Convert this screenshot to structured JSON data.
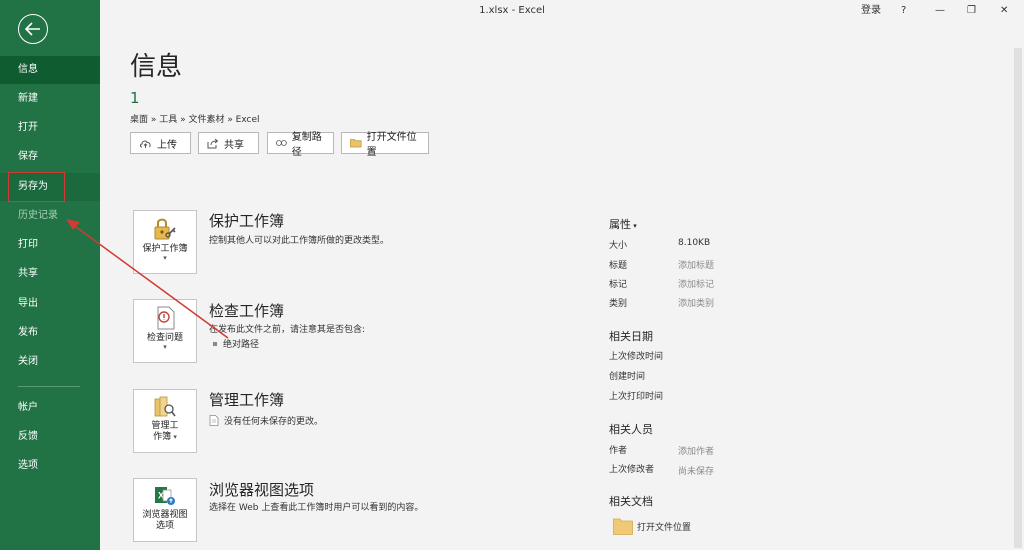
{
  "titlebar": {
    "title": "1.xlsx  -  Excel",
    "login": "登录",
    "help": "?",
    "minimize": "—",
    "restore": "❐",
    "close": "✕"
  },
  "sidebar": {
    "items": [
      {
        "label": "信息",
        "state": "active"
      },
      {
        "label": "新建"
      },
      {
        "label": "打开"
      },
      {
        "label": "保存"
      },
      {
        "label": "另存为",
        "state": "highlighted"
      },
      {
        "label": "历史记录",
        "state": "disabled"
      },
      {
        "label": "打印"
      },
      {
        "label": "共享"
      },
      {
        "label": "导出"
      },
      {
        "label": "发布"
      },
      {
        "label": "关闭"
      },
      {
        "label": "帐户"
      },
      {
        "label": "反馈"
      },
      {
        "label": "选项"
      }
    ]
  },
  "main": {
    "title": "信息",
    "file_name": "1",
    "breadcrumb": "桌面 » 工具 » 文件素材 » Excel",
    "buttons": {
      "upload": "上传",
      "share": "共享",
      "copy_path": "复制路径",
      "open_location": "打开文件位置"
    }
  },
  "sections": {
    "protect": {
      "card_label": "保护工作簿",
      "title": "保护工作簿",
      "desc": "控制其他人可以对此工作簿所做的更改类型。"
    },
    "inspect": {
      "card_label": "检查问题",
      "title": "检查工作簿",
      "desc": "在发布此文件之前，请注意其是否包含:",
      "bullet": "绝对路径"
    },
    "manage": {
      "card_label_1": "管理工",
      "card_label_2": "作簿",
      "title": "管理工作簿",
      "desc": "没有任何未保存的更改。"
    },
    "browser": {
      "card_label_1": "浏览器视图",
      "card_label_2": "选项",
      "title": "浏览器视图选项",
      "desc": "选择在 Web 上查看此工作簿时用户可以看到的内容。"
    }
  },
  "properties": {
    "header": "属性",
    "size_label": "大小",
    "size_value": "8.10KB",
    "title_label": "标题",
    "title_value": "添加标题",
    "tags_label": "标记",
    "tags_value": "添加标记",
    "category_label": "类别",
    "category_value": "添加类别"
  },
  "dates": {
    "header": "相关日期",
    "modified": "上次修改时间",
    "created": "创建时间",
    "printed": "上次打印时间"
  },
  "people": {
    "header": "相关人员",
    "author_label": "作者",
    "author_value": "添加作者",
    "last_modified_by_label": "上次修改者",
    "last_modified_by_value": "尚未保存"
  },
  "documents": {
    "header": "相关文档",
    "open_location": "打开文件位置"
  },
  "colors": {
    "sidebar": "#217346",
    "accent": "#217346",
    "annotation": "#d23a32"
  }
}
